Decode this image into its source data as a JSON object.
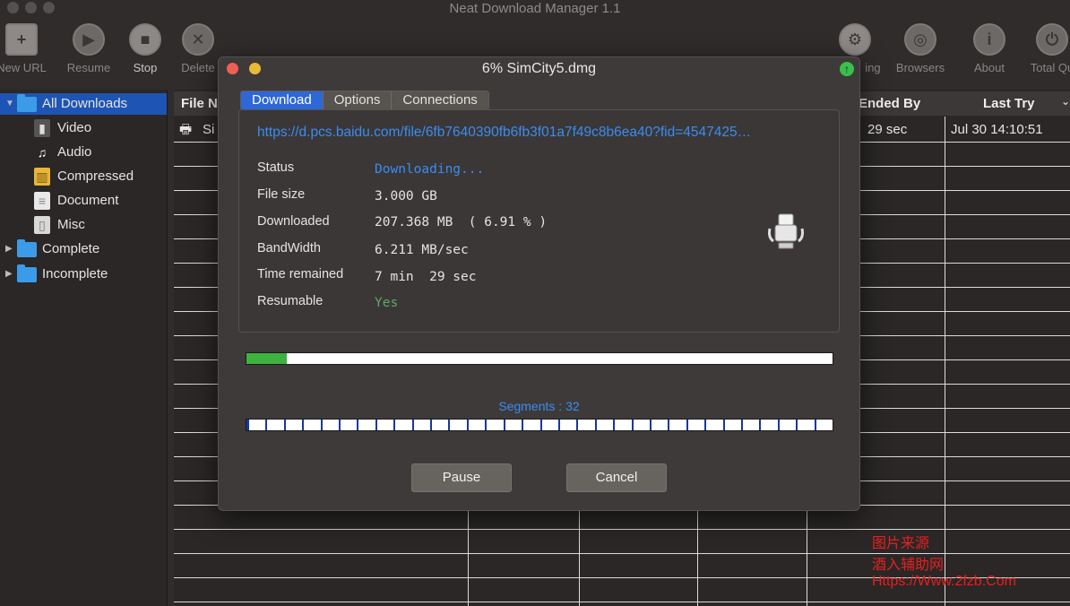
{
  "app": {
    "title": "Neat Download Manager 1.1"
  },
  "toolbar": {
    "new_url": "New URL",
    "resume": "Resume",
    "stop": "Stop",
    "delete": "Delete",
    "settings_partial": "ing",
    "browsers": "Browsers",
    "about": "About",
    "total_quit": "Total Qu"
  },
  "sidebar": {
    "all": "All Downloads",
    "video": "Video",
    "audio": "Audio",
    "compressed": "Compressed",
    "document": "Document",
    "misc": "Misc",
    "complete": "Complete",
    "incomplete": "Incomplete"
  },
  "table": {
    "col_file": "File Na",
    "col_ended": "Ended By",
    "col_last": "Last Try",
    "row1": {
      "file": "Si",
      "ended": "29 sec",
      "last": "Jul 30  14:10:51"
    }
  },
  "dialog": {
    "title": "6%  SimCity5.dmg",
    "tabs": [
      "Download",
      "Options",
      "Connections"
    ],
    "url": "https://d.pcs.baidu.com/file/6fb7640390fb6fb3f01a7f49c8b6ea40?fid=4547425…",
    "labels": {
      "status": "Status",
      "file_size": "File size",
      "downloaded": "Downloaded",
      "bandwidth": "BandWidth",
      "time_remained": "Time remained",
      "resumable": "Resumable"
    },
    "values": {
      "status": "Downloading...",
      "file_size": "3.000 GB",
      "downloaded": "207.368 MB  ( 6.91 % )",
      "bandwidth": "6.211 MB/sec",
      "time_remained": "7 min  29 sec",
      "resumable": "Yes"
    },
    "progress": 0.0691,
    "segments_label": "Segments : 32",
    "segments": 32,
    "pause": "Pause",
    "cancel": "Cancel"
  },
  "watermark": {
    "line1": "图片来源",
    "line2": "酒入辅助网",
    "line3": "Https://Www.2fzb.Com"
  },
  "colors": {
    "accent": "#2e67d6",
    "link": "#3b8cf2",
    "progress": "#3cb33e",
    "yes": "#5fa86a",
    "watermark": "#e62020"
  }
}
